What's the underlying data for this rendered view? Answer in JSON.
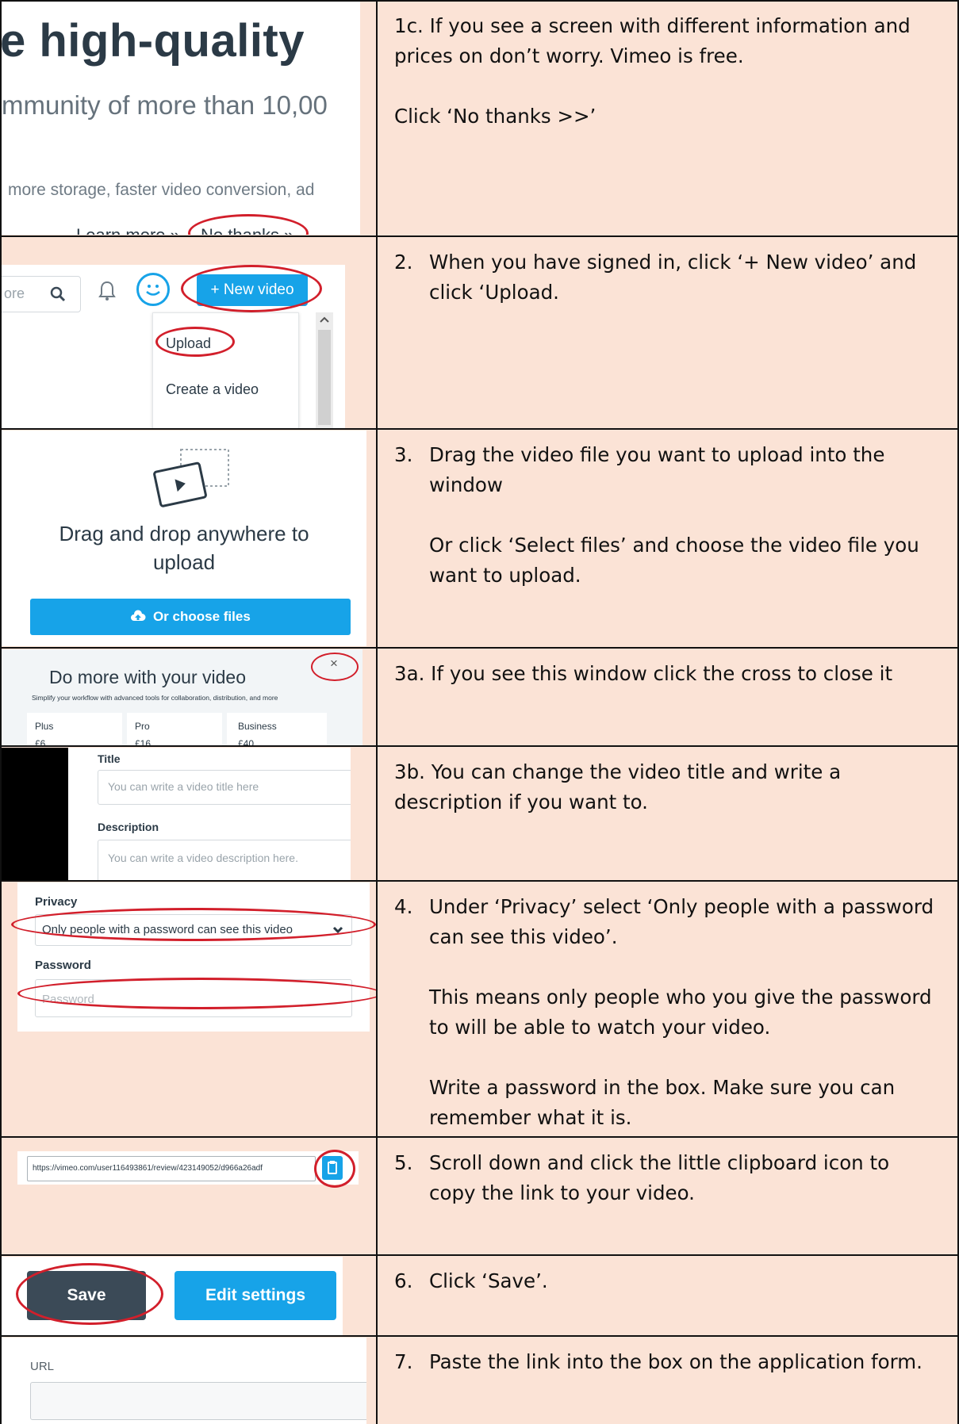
{
  "steps": [
    {
      "id": "1c",
      "text": "1c.  If you see a screen with different information and prices on don’t worry. Vimeo is free.",
      "text2": "Click ‘No thanks >>’",
      "screenshot": {
        "headline": "e high-quality",
        "sub": "mmunity of more than 10,00",
        "small": "more storage, faster video conversion, ad",
        "learn_more": "Learn more »",
        "no_thanks": "No thanks »"
      }
    },
    {
      "id": "2",
      "num": "2.",
      "text": "When you have signed in, click ‘+ New video’ and click ‘Upload.",
      "screenshot": {
        "search_fragment": "ore",
        "new_video": "+ New video",
        "upload": "Upload",
        "create": "Create a video"
      }
    },
    {
      "id": "3",
      "num": "3.",
      "text": "Drag the video file you want to upload into the window",
      "text2": "Or click ‘Select files’ and choose the video file you want to upload.",
      "screenshot": {
        "drag_text": "Drag and drop anywhere to upload",
        "choose": "Or choose files"
      }
    },
    {
      "id": "3a",
      "text": "3a.  If you see this window click the cross to close it",
      "screenshot": {
        "title": "Do more with your video",
        "subtitle": "Simplify your workflow with advanced tools for collaboration, distribution, and more",
        "close": "×",
        "plans": [
          "Plus",
          "Pro",
          "Business"
        ],
        "prices": [
          "£6",
          "£16",
          "£40"
        ]
      }
    },
    {
      "id": "3b",
      "text": "3b.  You can change the video title and write a description if you want to.",
      "screenshot": {
        "title_label": "Title",
        "title_placeholder": "You can write a video title here",
        "desc_label": "Description",
        "desc_placeholder": "You can write a video description here."
      }
    },
    {
      "id": "4",
      "num": "4.",
      "text": "Under ‘Privacy’ select ‘Only people with a password can see this video’.",
      "text2": "This means only people who you give the password to will be able to watch your video.",
      "text3": "Write a password in the box. Make sure you can remember what it is.",
      "screenshot": {
        "privacy_label": "Privacy",
        "privacy_value": "Only people with a password can see this video",
        "password_label": "Password",
        "password_placeholder": "Password"
      }
    },
    {
      "id": "5",
      "num": "5.",
      "text": "Scroll down and click the little clipboard icon to copy the link to your video.",
      "screenshot": {
        "url": "https://vimeo.com/user116493861/review/423149052/d966a26adf"
      }
    },
    {
      "id": "6",
      "num": "6.",
      "text": "Click ‘Save’.",
      "screenshot": {
        "save": "Save",
        "edit": "Edit settings"
      }
    },
    {
      "id": "7",
      "num": "7.",
      "text": "Paste the link into the box on the application form.",
      "screenshot": {
        "url_label": "URL"
      }
    }
  ],
  "colors": {
    "cell_bg": "#fbe3d6",
    "highlight": "#d21f2b",
    "vimeo_blue": "#17a3e8",
    "dark_button": "#3b4a57"
  }
}
